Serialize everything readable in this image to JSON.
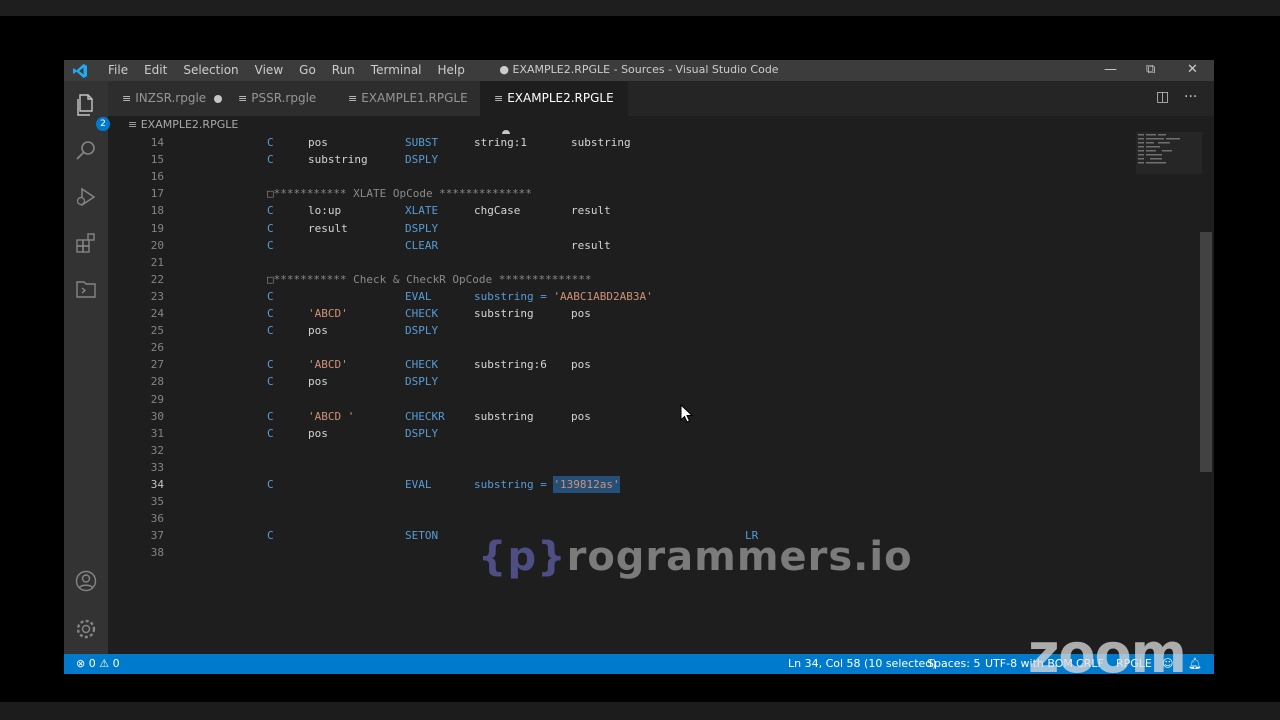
{
  "window_title": "● EXAMPLE2.RPGLE - Sources - Visual Studio Code",
  "menu": [
    "File",
    "Edit",
    "Selection",
    "View",
    "Go",
    "Run",
    "Terminal",
    "Help"
  ],
  "activity": {
    "icons": [
      "explorer-icon",
      "search-icon",
      "run-debug-icon",
      "extensions-icon",
      "remote-explorer-icon",
      "account-icon",
      "gear-icon"
    ],
    "explorer_badge": "2"
  },
  "tabs": [
    {
      "label": "INZSR.rpgle",
      "modified": true
    },
    {
      "label": "PSSR.rpgle",
      "modified": false
    },
    {
      "label": "EXAMPLE1.RPGLE",
      "modified": false
    },
    {
      "label": "EXAMPLE2.RPGLE",
      "modified": true,
      "active": true
    }
  ],
  "breadcrumb": "EXAMPLE2.RPGLE",
  "code": [
    {
      "n": "14",
      "spec": "C",
      "factor1": "pos",
      "op": "SUBST",
      "factor2": "string:1",
      "result": "substring"
    },
    {
      "n": "15",
      "spec": "C",
      "factor1": "substring",
      "op": "DSPLY"
    },
    {
      "n": "16"
    },
    {
      "n": "17",
      "comment": "□*********** XLATE OpCode **************"
    },
    {
      "n": "18",
      "spec": "C",
      "factor1": "lo:up",
      "op": "XLATE",
      "factor2": "chgCase",
      "result": "result"
    },
    {
      "n": "19",
      "spec": "C",
      "factor1": "result",
      "op": "DSPLY"
    },
    {
      "n": "20",
      "spec": "C",
      "op": "CLEAR",
      "result": "result"
    },
    {
      "n": "21"
    },
    {
      "n": "22",
      "comment": "□*********** Check & CheckR OpCode **************"
    },
    {
      "n": "23",
      "spec": "C",
      "op": "EVAL",
      "factor2": "substring = ",
      "factor2_str": "'AABC1ABD2AB3A'"
    },
    {
      "n": "24",
      "spec": "C",
      "factor1_str": "'ABCD'",
      "op": "CHECK",
      "factor2": "substring",
      "result": "pos"
    },
    {
      "n": "25",
      "spec": "C",
      "factor1": "pos",
      "op": "DSPLY"
    },
    {
      "n": "26"
    },
    {
      "n": "27",
      "spec": "C",
      "factor1_str": "'ABCD'",
      "op": "CHECK",
      "factor2": "substring:6",
      "result": "pos"
    },
    {
      "n": "28",
      "spec": "C",
      "factor1": "pos",
      "op": "DSPLY"
    },
    {
      "n": "29"
    },
    {
      "n": "30",
      "spec": "C",
      "factor1_str": "'ABCD '",
      "op": "CHECKR",
      "factor2": "substring",
      "result": "pos"
    },
    {
      "n": "31",
      "spec": "C",
      "factor1": "pos",
      "op": "DSPLY"
    },
    {
      "n": "32"
    },
    {
      "n": "33"
    },
    {
      "n": "34",
      "spec": "C",
      "op": "EVAL",
      "factor2": "substring = ",
      "factor2_str": "'139812as'",
      "current": true
    },
    {
      "n": "35"
    },
    {
      "n": "36"
    },
    {
      "n": "37",
      "spec": "C",
      "op": "SETON",
      "indicator": "LR"
    },
    {
      "n": "38"
    }
  ],
  "watermark": {
    "brace": "{p}",
    "text": "rogrammers.io"
  },
  "status": {
    "errors": "0",
    "warnings": "0",
    "position": "Ln 34, Col 58 (10 selected)",
    "spaces": "Spaces: 5",
    "encoding": "UTF-8 with BOM",
    "eol": "CRLF",
    "language": "RPGLE"
  },
  "overlay_logo": "zoom",
  "colors": {
    "accent": "#007acc",
    "keyword": "#569cd6",
    "string": "#ce9178"
  }
}
